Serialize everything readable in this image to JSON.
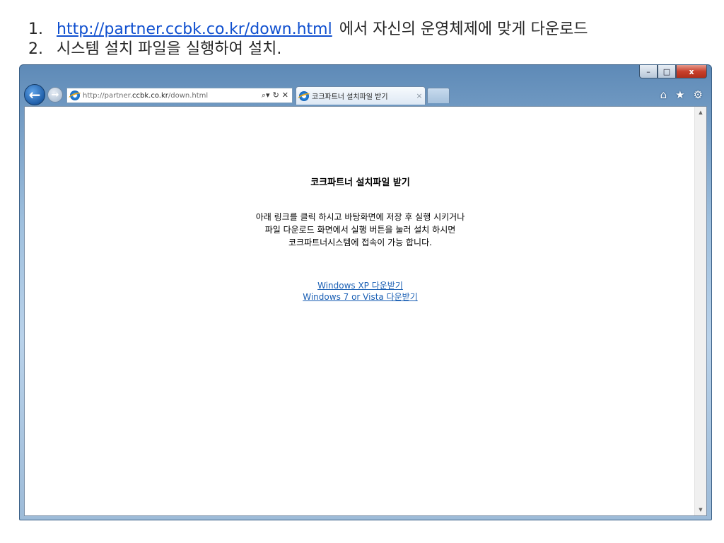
{
  "instructions": {
    "step1": {
      "number": "1.",
      "link": "http://partner.ccbk.co.kr/down.html",
      "text": "에서 자신의 운영체제에 맞게 다운로드"
    },
    "step2": {
      "number": "2.",
      "text": "시스템 설치 파일을 실행하여 설치."
    }
  },
  "browser": {
    "address": {
      "prefix": "http://partner.",
      "domain": "ccbk.co.kr",
      "path": "/down.html"
    },
    "tab": {
      "title": "코크파트너 설치파일 받기",
      "close": "×"
    },
    "window_controls": {
      "minimize": "–",
      "maximize": "□",
      "close": "x"
    },
    "icons": [
      "back-arrow-icon",
      "forward-arrow-icon",
      "ie-logo-icon",
      "search-icon",
      "refresh-icon",
      "stop-icon",
      "home-icon",
      "favorites-star-icon",
      "settings-gear-icon"
    ]
  },
  "page": {
    "title": "코크파트너 설치파일 받기",
    "description": [
      "아래 링크를 클릭 하시고 바탕화면에 저장 후 실행 시키거나",
      "파일 다운로드 화면에서 실행 버튼을 눌러 설치 하시면",
      "코크파트너시스템에 접속이 가능 합니다."
    ],
    "links": {
      "xp": "Windows XP 다운받기",
      "win7": "Windows 7 or Vista 다운받기"
    }
  },
  "colors": {
    "link": "#1a5fb4",
    "slide_link": "#0f4fcf",
    "close_button": "#c8402c",
    "chrome": "#9fc0de"
  }
}
